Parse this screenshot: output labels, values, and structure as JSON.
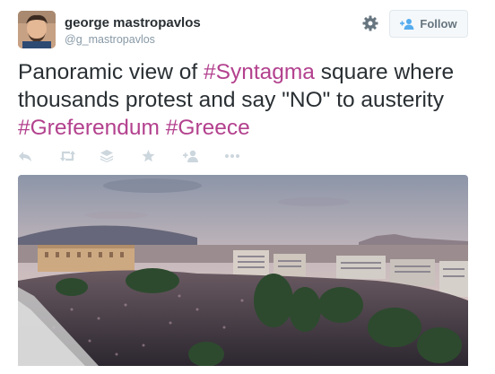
{
  "user": {
    "display_name": "george mastropavlos",
    "handle": "@g_mastropavlos"
  },
  "header": {
    "follow_label": "Follow"
  },
  "tweet": {
    "segments_line1": [
      "Panoramic view of ",
      "#Syntagma",
      " square where"
    ],
    "line2": "thousands protest and say \"NO\" to austerity",
    "hashtag_greferendum": "#Greferendum",
    "hashtag_greece": "#Greece",
    "space": " "
  },
  "colors": {
    "hashtag": "#b3418e",
    "text": "#292f33",
    "muted": "#8899a6",
    "action_icon": "#ccd6dd"
  },
  "actions": [
    "reply-icon",
    "retweet-icon",
    "stack-icon",
    "favorite-icon",
    "follow-icon",
    "more-icon"
  ],
  "media": {
    "type": "photo"
  }
}
